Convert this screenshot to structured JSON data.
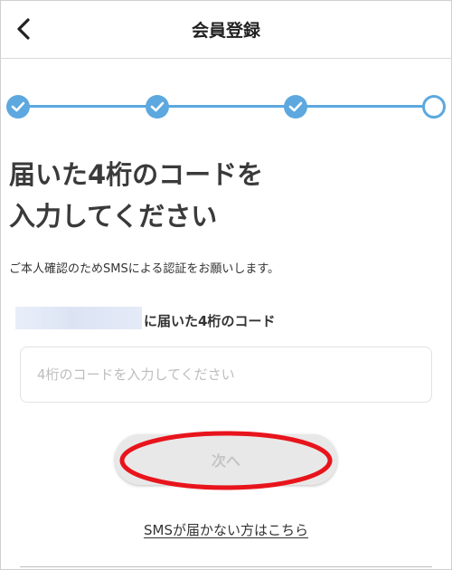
{
  "header": {
    "title": "会員登録",
    "back_icon": "chevron-left-icon"
  },
  "stepper": {
    "total_steps": 4,
    "completed_steps": 3,
    "current_step": 4,
    "accent_color": "#5da8df"
  },
  "main": {
    "heading_line1": "届いた4桁のコードを",
    "heading_line2": "入力してください",
    "description": "ご本人確認のためSMSによる認証をお願いします。",
    "code_label": "に届いた4桁のコード",
    "code_input": {
      "value": "",
      "placeholder": "4桁のコードを入力してください"
    },
    "next_label": "次へ",
    "sms_link_label": "SMSが届かない方はこちら"
  }
}
